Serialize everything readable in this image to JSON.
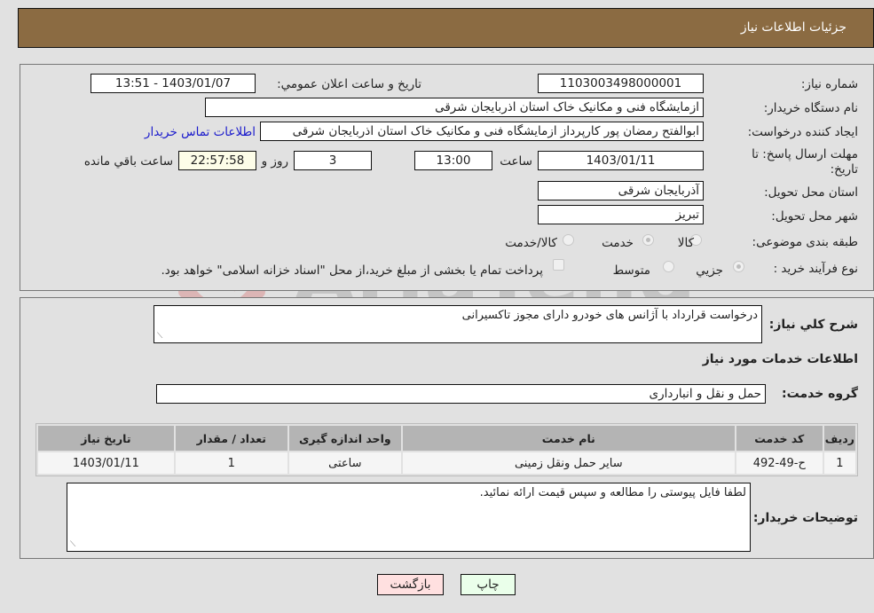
{
  "header": {
    "title": "جزئیات اطلاعات نیاز"
  },
  "form": {
    "need_number_label": "شماره نیاز:",
    "need_number": "1103003498000001",
    "announce_label": "تاریخ و ساعت اعلان عمومي:",
    "announce_value": "1403/01/07 - 13:51",
    "buyer_org_label": "نام دستگاه خریدار:",
    "buyer_org": "ازمایشگاه فنی و مکانیک خاک استان اذربایجان شرقی",
    "creator_label": "ایجاد کننده درخواست:",
    "creator": "ابوالفتح رمضان پور کارپرداز ازمایشگاه فنی و مکانیک خاک استان اذربایجان شرقی",
    "contact_link": "اطلاعات تماس خریدار",
    "deadline_label_1": "مهلت ارسال پاسخ: تا",
    "deadline_label_2": "تاریخ:",
    "deadline_date": "1403/01/11",
    "time_label": "ساعت",
    "deadline_time": "13:00",
    "days_value": "3",
    "days_label": "روز و",
    "remaining_time": "22:57:58",
    "remaining_label": "ساعت باقي مانده",
    "province_label": "استان محل تحویل:",
    "province": "آذربایجان شرقی",
    "city_label": "شهر محل تحویل:",
    "city": "تبریز",
    "category_label": "طبقه بندی موضوعی:",
    "category_options": [
      "کالا",
      "خدمت",
      "کالا/خدمت"
    ],
    "category_selected": "خدمت",
    "process_label": "نوع فرآیند خرید :",
    "process_options": [
      "جزيي",
      "متوسط"
    ],
    "process_selected": "جزيي",
    "treasury_note": "پرداخت تمام یا بخشی از مبلغ خرید،از محل \"اسناد خزانه اسلامی\" خواهد بود."
  },
  "details": {
    "summary_label": "شرح کلي نیاز:",
    "summary": "درخواست قرارداد با آژانس های خودرو دارای مجوز تاکسیرانی",
    "services_heading": "اطلاعات خدمات مورد نیاز",
    "service_group_label": "گروه خدمت:",
    "service_group": "حمل و نقل و انبارداری",
    "table": {
      "columns": [
        "ردیف",
        "کد خدمت",
        "نام خدمت",
        "واحد اندازه گیری",
        "تعداد / مقدار",
        "تاریخ نیاز"
      ],
      "rows": [
        [
          "1",
          "ح-49-492",
          "سایر حمل ونقل زمینی",
          "ساعتی",
          "1",
          "1403/01/11"
        ]
      ]
    },
    "buyer_notes_label": "توضیحات خریدار:",
    "buyer_notes": "لطفا فایل پیوستی را مطالعه و سپس قیمت ارائه نمائید."
  },
  "buttons": {
    "print": "چاپ",
    "back": "بازگشت"
  },
  "watermark": {
    "text": "AriaTender.neT"
  },
  "colors": {
    "header_bg": "#8b6b42",
    "print_bg": "#eaffea",
    "back_bg": "#ffe0e0",
    "link": "#1a1acc"
  }
}
